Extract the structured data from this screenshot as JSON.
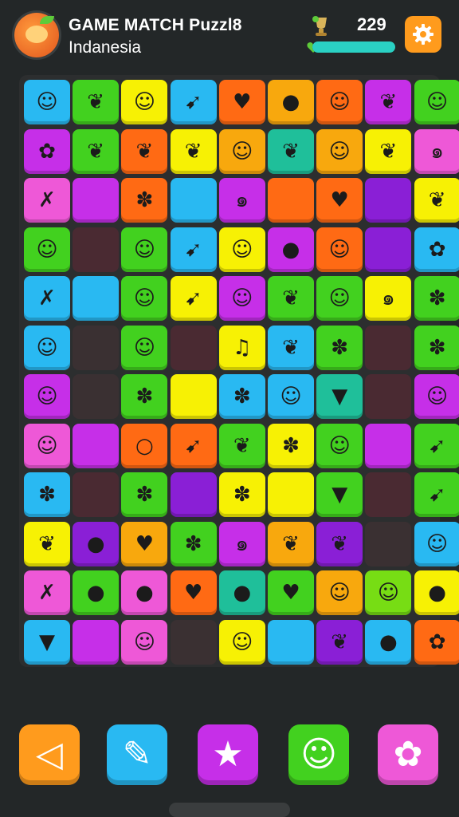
{
  "header": {
    "title": "GAME MATCH Puzzl8",
    "subtitle": "Indanesia",
    "score": "229",
    "progress": 1.0,
    "logo_icon": "orange-fruit-logo",
    "score_icon": "trophy-icon",
    "progress_icon": "heart-icon",
    "settings_icon": "gear-icon",
    "colors": {
      "progress": "#2ad1c4",
      "settings": "#ff9b1d"
    }
  },
  "board": {
    "rows": 12,
    "cols": 9,
    "palette": {
      "C": "#29b9f2",
      "Y": "#f7f104",
      "O": "#f8a80d",
      "R": "#ff6a14",
      "G": "#42d11f",
      "P": "#c62fe8",
      "V": "#8a1fd6",
      "K": "#ee58d7",
      "T": "#1fbf9a",
      "L": "#77dd14",
      "X": "#4a2a32",
      "D": "#3a3032"
    },
    "tiles": [
      [
        "C:face",
        "G:leaf",
        "Y:face",
        "C:carrot",
        "R:heart",
        "O:fruit",
        "R:face",
        "P:leaf",
        "G:face"
      ],
      [
        "P:flower",
        "G:leaf",
        "R:leaf",
        "Y:leaf",
        "O:face",
        "T:leaf",
        "O:face",
        "Y:leaf",
        "K:swirl"
      ],
      [
        "K:ribbon",
        "P:",
        "R:blob",
        "C:",
        "P:swirl",
        "R:",
        "R:heart",
        "V:",
        "Y:leaf"
      ],
      [
        "G:face",
        "X:",
        "G:face",
        "C:carrot",
        "Y:face",
        "P:fruit",
        "R:face",
        "V:",
        "C:flower"
      ],
      [
        "C:ribbon",
        "C:",
        "G:face",
        "Y:carrot",
        "P:face",
        "G:leaf",
        "G:face",
        "Y:swirl",
        "G:blob"
      ],
      [
        "C:face",
        "D:",
        "G:face",
        "X:",
        "Y:music",
        "C:leaf",
        "G:blob",
        "X:",
        "G:blob"
      ],
      [
        "P:face",
        "D:",
        "G:blob",
        "Y:",
        "C:blob",
        "C:face",
        "T:cone",
        "X:",
        "P:face"
      ],
      [
        "K:face",
        "P:",
        "R:circle",
        "R:carrot",
        "G:leaf",
        "Y:blob",
        "G:face",
        "P:",
        "G:carrot"
      ],
      [
        "C:blob",
        "X:",
        "G:blob",
        "V:",
        "Y:blob",
        "Y:",
        "G:cone",
        "X:",
        "G:carrot"
      ],
      [
        "Y:leaf",
        "V:fruit",
        "O:heart",
        "G:blob",
        "P:swirl",
        "O:leaf",
        "V:leaf",
        "D:",
        "C:face"
      ],
      [
        "K:ribbon",
        "G:fruit",
        "K:fruit",
        "R:heart",
        "T:fruit",
        "G:heart",
        "O:face",
        "L:face",
        "Y:fruit"
      ],
      [
        "C:cone",
        "P:",
        "K:face",
        "D:",
        "Y:face",
        "C:",
        "V:leaf",
        "C:fruit",
        "R:flower"
      ]
    ]
  },
  "dock": {
    "buttons": [
      {
        "icon": "arrow-icon",
        "color": "#ff9b1d",
        "glyph": "◁"
      },
      {
        "icon": "pencil-icon",
        "color": "#29b9f2",
        "glyph": "✎"
      },
      {
        "icon": "star-icon",
        "color": "#c62fe8",
        "glyph": "★"
      },
      {
        "icon": "face-icon",
        "color": "#42d11f",
        "glyph": "☺"
      },
      {
        "icon": "gear-icon",
        "color": "#ee58d7",
        "glyph": "✿"
      }
    ]
  }
}
